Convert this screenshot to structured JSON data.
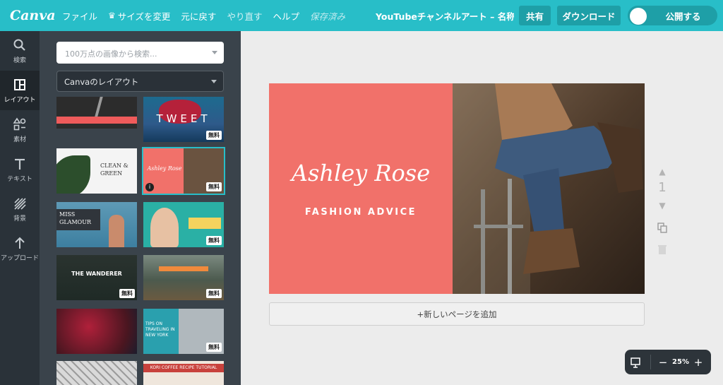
{
  "app": {
    "logo": "Canva"
  },
  "menu": {
    "file": "ファイル",
    "resize": "サイズを変更",
    "undo": "元に戻す",
    "redo": "やり直す",
    "help": "ヘルプ",
    "saved": "保存済み"
  },
  "doc_title": "YouTubeチャンネルアート – 名称未...",
  "actions": {
    "share": "共有",
    "download": "ダウンロード",
    "publish": "公開する"
  },
  "nav": [
    {
      "label": "検索",
      "icon": "search-icon"
    },
    {
      "label": "レイアウト",
      "icon": "layout-icon",
      "active": true
    },
    {
      "label": "素材",
      "icon": "elements-icon"
    },
    {
      "label": "テキスト",
      "icon": "text-icon"
    },
    {
      "label": "背景",
      "icon": "background-icon"
    },
    {
      "label": "アップロード",
      "icon": "upload-icon"
    }
  ],
  "panel": {
    "search_placeholder": "100万点の画像から検索...",
    "category": "Canvaのレイアウト",
    "free_badge": "無料",
    "thumb_texts": {
      "tweet": "TWEET",
      "clean": "CLEAN &",
      "green": "GREEN",
      "miss": "MISS",
      "glamour": "GLAMOUR",
      "ashley": "Ashley Rose",
      "wanderer": "THE WANDERER",
      "tips": "TIPS ON TRAVELING IN NEW YORK",
      "kori": "KORI COFFEE RECIPE TUTORIAL"
    }
  },
  "design": {
    "name": "Ashley Rose",
    "subtitle": "FASHION ADVICE"
  },
  "add_page": "+新しいページを追加",
  "page_number": "1",
  "zoom": {
    "level": "25%",
    "minus": "−",
    "plus": "+"
  },
  "colors": {
    "topbar": "#28bec8",
    "design_bg": "#f1716a",
    "nav_bg": "#2a3239",
    "panel_bg": "#3a434b"
  }
}
